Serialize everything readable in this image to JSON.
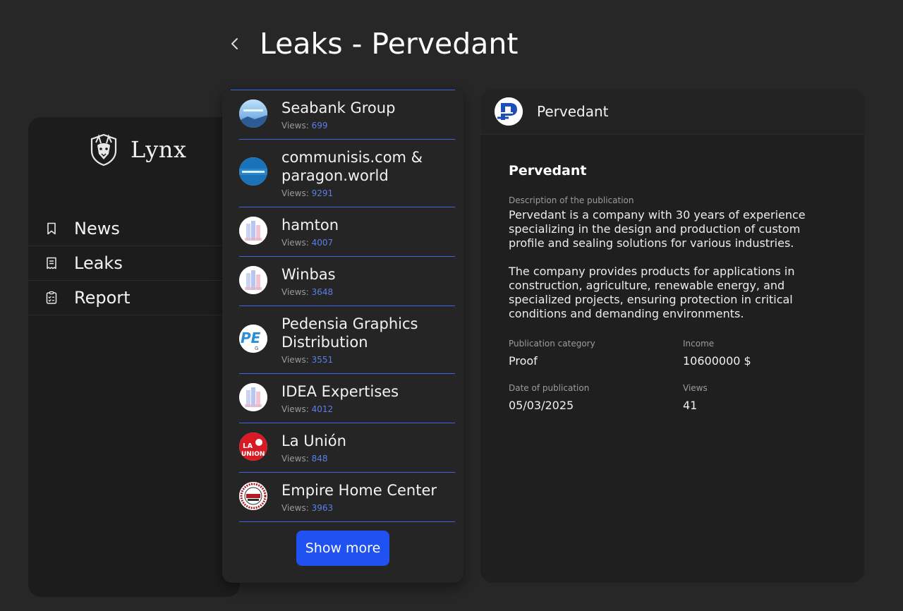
{
  "page": {
    "title": "Leaks - Pervedant"
  },
  "brand": {
    "name": "Lynx"
  },
  "nav": [
    {
      "label": "News",
      "icon": "bookmark-icon"
    },
    {
      "label": "Leaks",
      "icon": "receipt-icon"
    },
    {
      "label": "Report",
      "icon": "checklist-icon"
    }
  ],
  "leaks": [
    {
      "name": "Seabank Group",
      "views_label": "Views:",
      "views": "699"
    },
    {
      "name": "communisis.com & paragon.world",
      "views_label": "Views:",
      "views": "9291"
    },
    {
      "name": "hamton",
      "views_label": "Views:",
      "views": "4007"
    },
    {
      "name": "Winbas",
      "views_label": "Views:",
      "views": "3648"
    },
    {
      "name": "Pedensia Graphics Distribution",
      "views_label": "Views:",
      "views": "3551"
    },
    {
      "name": "IDEA Expertises",
      "views_label": "Views:",
      "views": "4012"
    },
    {
      "name": "La Unión",
      "views_label": "Views:",
      "views": "848"
    },
    {
      "name": "Empire Home Center",
      "views_label": "Views:",
      "views": "3963"
    }
  ],
  "list": {
    "show_more": "Show more"
  },
  "detail": {
    "header_name": "Pervedant",
    "title": "Pervedant",
    "description_label": "Description of the publication",
    "description_p1": "Pervedant is a company with 30 years of experience specializing in the design and production of custom profile and sealing solutions for various industries.",
    "description_p2": "The company provides products for applications in construction, agriculture, renewable energy, and specialized projects, ensuring protection in critical conditions and demanding environments.",
    "category_label": "Publication category",
    "category_value": "Proof",
    "income_label": "Income",
    "income_value": "10600000 $",
    "date_label": "Date of publication",
    "date_value": "05/03/2025",
    "views_label": "Views",
    "views_value": "41"
  },
  "colors": {
    "accent": "#1f52f0",
    "divider": "#3c63e8",
    "views_number": "#5b7fe6"
  }
}
